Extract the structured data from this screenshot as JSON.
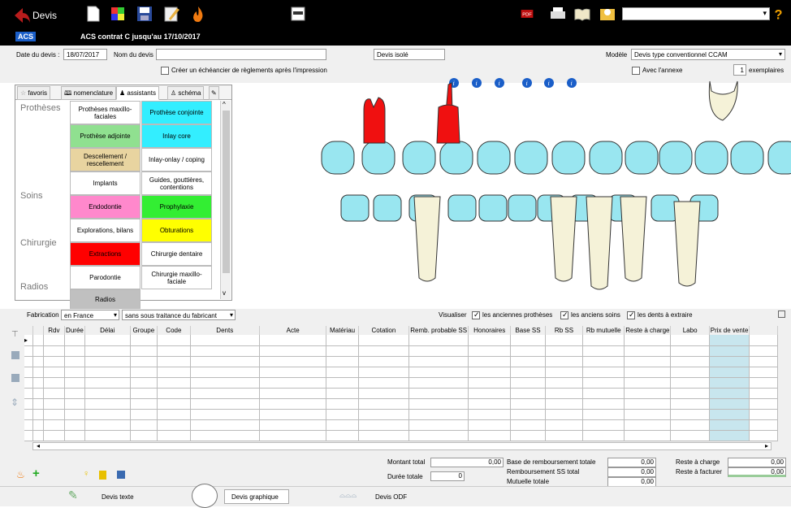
{
  "toolbar": {
    "title": "Devis",
    "right_select": ""
  },
  "acs": {
    "badge": "ACS",
    "text": "ACS contrat C jusqu'au 17/10/2017"
  },
  "form": {
    "date_label": "Date du devis :",
    "date_value": "18/07/2017",
    "name_label": "Nom du devis",
    "name_value": "",
    "type_value": "Devis isolé",
    "model_label": "Modèle",
    "model_value": "Devis type conventionnel CCAM",
    "echeancier_label": "Créer un échéancier de règlements après l'impression",
    "annexe_label": "Avec l'annexe",
    "exemplaires_count": "1",
    "exemplaires_label": "exemplaires"
  },
  "tabs": [
    "favoris",
    "nomenclature",
    "assistants",
    "schéma"
  ],
  "categories": [
    "Prothèses",
    "Soins",
    "Chirurgie",
    "Radios"
  ],
  "cells": [
    {
      "label": "Prothèses maxillo-faciales",
      "color": "#ffffff"
    },
    {
      "label": "Prothèse conjointe",
      "color": "#33eeff"
    },
    {
      "label": "Prothèse adjointe",
      "color": "#90e090"
    },
    {
      "label": "Inlay core",
      "color": "#33eeff"
    },
    {
      "label": "Descellement / rescellement",
      "color": "#e8d4a0"
    },
    {
      "label": "Inlay-onlay / coping",
      "color": "#ffffff"
    },
    {
      "label": "Implants",
      "color": "#ffffff"
    },
    {
      "label": "Guides, gouttières, contentions",
      "color": "#ffffff"
    },
    {
      "label": "Endodontie",
      "color": "#ff88cc"
    },
    {
      "label": "Prophylaxie",
      "color": "#33ee33"
    },
    {
      "label": "Explorations, bilans",
      "color": "#ffffff"
    },
    {
      "label": "Obturations",
      "color": "#ffff00"
    },
    {
      "label": "Extractions",
      "color": "#ff0000"
    },
    {
      "label": "Chirurgie dentaire",
      "color": "#ffffff"
    },
    {
      "label": "Parodontie",
      "color": "#ffffff"
    },
    {
      "label": "Chirurgie maxillo-faciale",
      "color": "#ffffff"
    },
    {
      "label": "Radios",
      "color": "#c0c0c0"
    }
  ],
  "fabrication": {
    "label": "Fabrication",
    "place": "en France",
    "mode": "sans sous traitance du fabricant"
  },
  "visualiser": {
    "label": "Visualiser",
    "opts": [
      "les anciennes prothèses",
      "les anciens soins",
      "les dents à extraire"
    ]
  },
  "columns": [
    "Rdv",
    "Durée",
    "Délai",
    "Groupe",
    "Code",
    "Dents",
    "Acte",
    "Matériau",
    "Cotation",
    "Remb. probable SS",
    "Honoraires",
    "Base SS",
    "Rb SS",
    "Rb mutuelle",
    "Reste à charge",
    "Labo",
    "Prix de vente"
  ],
  "totals": {
    "montant_label": "Montant total",
    "montant": "0,00",
    "duree_label": "Durée totale",
    "duree": "0",
    "base_label": "Base de remboursement totale",
    "base": "0,00",
    "rss_label": "Remboursement SS total",
    "rss": "0,00",
    "mut_label": "Mutuelle totale",
    "mut": "0,00",
    "reste_label": "Reste à charge",
    "reste": "0,00",
    "facturer_label": "Reste à facturer",
    "facturer": "0,00"
  },
  "bottom_tabs": [
    "Devis texte",
    "Devis graphique",
    "Devis ODF"
  ],
  "colors": {
    "tooth": "#99e6f0",
    "crown_red": "#f01010",
    "root": "#f5f2d8",
    "info": "#1a5ec8"
  }
}
